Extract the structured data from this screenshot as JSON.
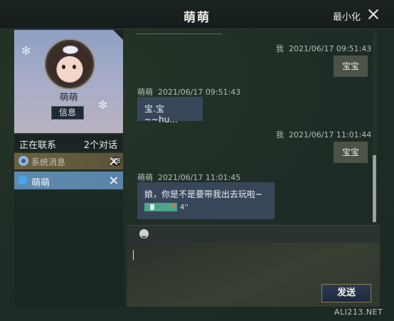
{
  "window": {
    "title": "萌萌",
    "minimize_label": "最小化"
  },
  "profile": {
    "name": "萌萌",
    "info_button": "信息"
  },
  "contacts": {
    "header_label": "正在联系",
    "conversation_count": "2个对话",
    "rows": [
      {
        "label": "系统消息",
        "badge": "18",
        "icon": "gear-icon"
      },
      {
        "label": "萌萌",
        "icon": "chat-bubble-icon"
      }
    ]
  },
  "messages": [
    {
      "sender": "我",
      "time": "2021/06/17  09:51:43",
      "text": "宝宝"
    },
    {
      "sender": "萌萌",
      "time": "2021/06/17  09:51:43",
      "text": "宝.宝~~hu..."
    },
    {
      "sender": "我",
      "time": "2021/06/17  11:01:44",
      "text": "宝宝"
    },
    {
      "sender": "萌萌",
      "time": "2021/06/17  11:01:45",
      "text": "娘，你是不是要带我出去玩啦~",
      "voice_length": "4''"
    }
  ],
  "composer": {
    "input_value": "",
    "send_label": "发送"
  },
  "watermark": "ALI213.NET"
}
